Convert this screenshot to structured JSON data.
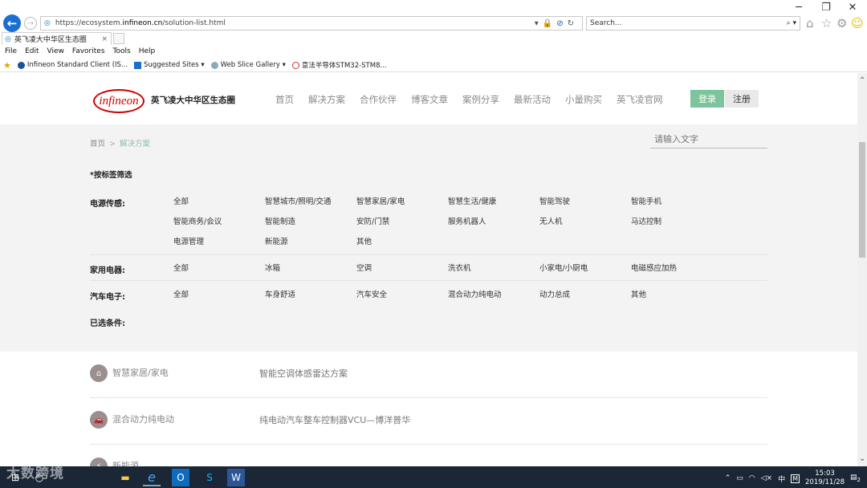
{
  "browser": {
    "url_prefix": "https://ecosystem.",
    "url_host": "infineon.cn",
    "url_path": "/solution-list.html",
    "search_placeholder": "Search...",
    "tab_title": "英飞凌大中华区生态圈",
    "tab_close": "×",
    "menu": [
      "File",
      "Edit",
      "View",
      "Favorites",
      "Tools",
      "Help"
    ],
    "favorites": [
      "Infineon Standard Client (IS...",
      "Suggested Sites ▾",
      "Web Slice Gallery ▾",
      "意法半导体STM32-STM8..."
    ],
    "window_controls": [
      "─",
      "❐",
      "✕"
    ]
  },
  "header": {
    "logo_text": "infineon",
    "site_name": "英飞凌大中华区生态圈",
    "nav": [
      "首页",
      "解决方案",
      "合作伙伴",
      "博客文章",
      "案例分享",
      "最新活动",
      "小量购买",
      "英飞凌官网"
    ],
    "login": "登录",
    "register": "注册"
  },
  "breadcrumb": {
    "home": "首页",
    "sep": ">",
    "current": "解决方案"
  },
  "search_input_placeholder": "请输入文字",
  "filters": {
    "title": "*按标签筛选",
    "groups": [
      {
        "label": "电源传感:",
        "options": [
          "全部",
          "智慧城市/照明/交通",
          "智慧家居/家电",
          "智慧生活/健康",
          "智能驾驶",
          "智能手机",
          "智能商务/会议",
          "智能制造",
          "安防/门禁",
          "服务机器人",
          "无人机",
          "马达控制",
          "电源管理",
          "新能源",
          "其他"
        ]
      },
      {
        "label": "家用电器:",
        "options": [
          "全部",
          "冰箱",
          "空调",
          "洗衣机",
          "小家电/小厨电",
          "电磁感应加热"
        ]
      },
      {
        "label": "汽车电子:",
        "options": [
          "全部",
          "车身舒适",
          "汽车安全",
          "混合动力纯电动",
          "动力总成",
          "其他"
        ]
      }
    ],
    "selected_label": "已选条件:"
  },
  "results": [
    {
      "category": "智慧家居/家电",
      "title": "智能空调体感雷达方案"
    },
    {
      "category": "混合动力纯电动",
      "title": "纯电动汽车整车控制器VCU—博洋普华"
    },
    {
      "category": "新能源",
      "title": ""
    }
  ],
  "taskbar": {
    "watermark": "大数跨境",
    "ime": "中",
    "time": "15:03",
    "date": "2019/11/28",
    "notif_count": "2"
  }
}
